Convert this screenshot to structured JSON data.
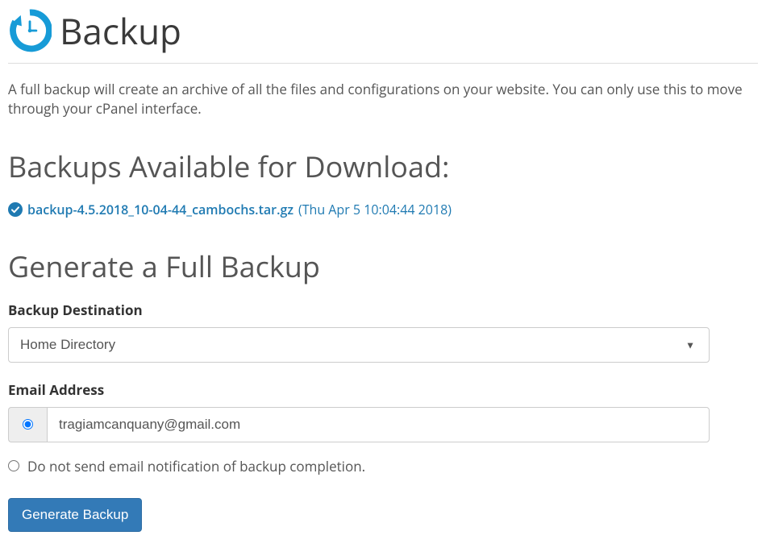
{
  "header": {
    "title": "Backup"
  },
  "description": "A full backup will create an archive of all the files and configurations on your website. You can only use this to move through your cPanel interface.",
  "backups": {
    "heading": "Backups Available for Download:",
    "filename": "backup-4.5.2018_10-04-44_cambochs.tar.gz",
    "date": "(Thu Apr 5 10:04:44 2018)"
  },
  "form": {
    "heading": "Generate a Full Backup",
    "destination_label": "Backup Destination",
    "destination_value": "Home Directory",
    "email_label": "Email Address",
    "email_value": "tragiamcanquany@gmail.com",
    "skip_email_label": "Do not send email notification of backup completion.",
    "submit_label": "Generate Backup"
  },
  "colors": {
    "accent": "#1f7ab2",
    "button": "#337ab7",
    "icon": "#179bd7"
  }
}
